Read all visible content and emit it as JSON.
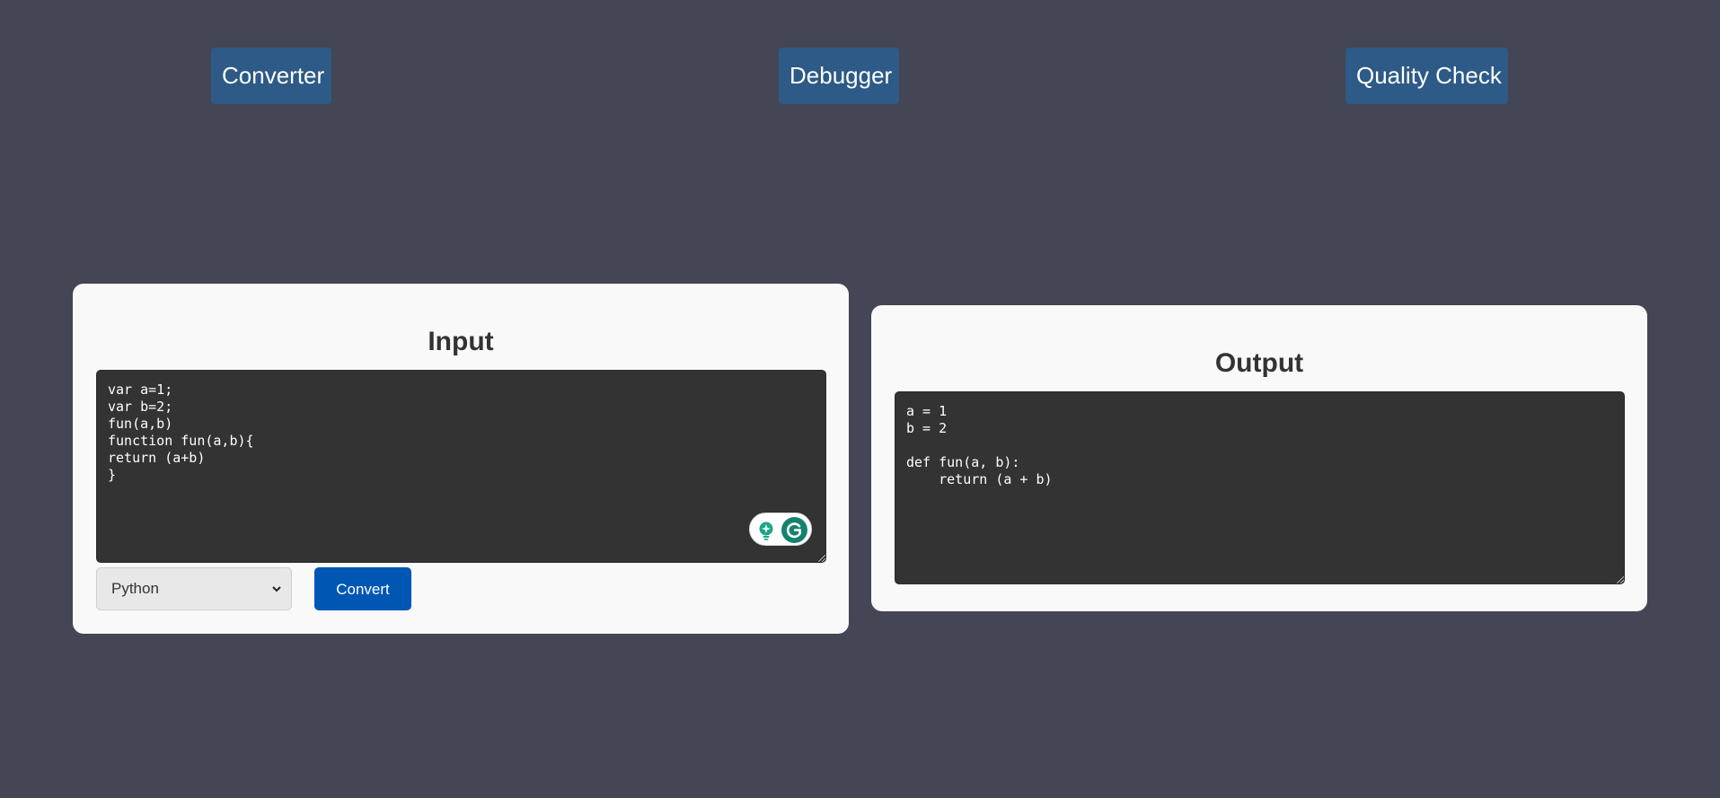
{
  "nav": {
    "converter_label": "Converter",
    "debugger_label": "Debugger",
    "quality_check_label": "Quality Check"
  },
  "input_panel": {
    "title": "Input",
    "code": "var a=1;\nvar b=2;\nfun(a,b)\nfunction fun(a,b){\nreturn (a+b)\n}",
    "language_selected": "Python",
    "convert_label": "Convert"
  },
  "output_panel": {
    "title": "Output",
    "code": "a = 1\nb = 2\n\ndef fun(a, b):\n    return (a + b)"
  },
  "colors": {
    "page_background": "#444655",
    "nav_button": "#2d5a86",
    "panel_background": "#f9f9f9",
    "code_background": "#333333",
    "primary_button": "#0056b3"
  },
  "icons": {
    "grammarly": "grammarly-icon",
    "assistant": "lightbulb-icon",
    "select": "chevron-down-icon",
    "resize": "resize-grip-icon"
  }
}
